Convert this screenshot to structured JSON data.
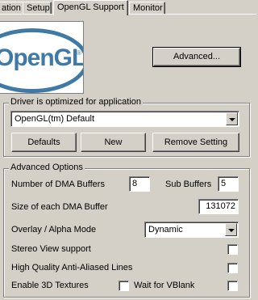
{
  "tabs": [
    {
      "label": "ation"
    },
    {
      "label": "Setup"
    },
    {
      "label": "OpenGL Support",
      "active": true
    },
    {
      "label": "Monitor"
    }
  ],
  "logo": {
    "text": "OpenGL",
    "tm": "®"
  },
  "buttons": {
    "advanced": "Advanced...",
    "defaults": "Defaults",
    "new": "New",
    "remove": "Remove Setting"
  },
  "driver_group": {
    "title": "Driver is optimized for application",
    "selected": "OpenGL(tm) Default"
  },
  "advanced_group": {
    "title": "Advanced Options",
    "dma_buffers_label": "Number of DMA Buffers",
    "dma_buffers_value": "8",
    "sub_buffers_label": "Sub Buffers",
    "sub_buffers_value": "5",
    "dma_size_label": "Size of each DMA Buffer",
    "dma_size_value": "131072",
    "overlay_label": "Overlay / Alpha Mode",
    "overlay_value": "Dynamic",
    "stereo_label": "Stereo View support",
    "aa_lines_label": "High Quality Anti-Aliased Lines",
    "textures_label": "Enable 3D Textures",
    "vblank_label": "Wait for VBlank"
  },
  "checkboxes": {
    "stereo": false,
    "aa_lines": false,
    "textures": false,
    "vblank": false
  },
  "colors": {
    "face": "#d4d0c8",
    "logo": "#3f7aa6"
  }
}
